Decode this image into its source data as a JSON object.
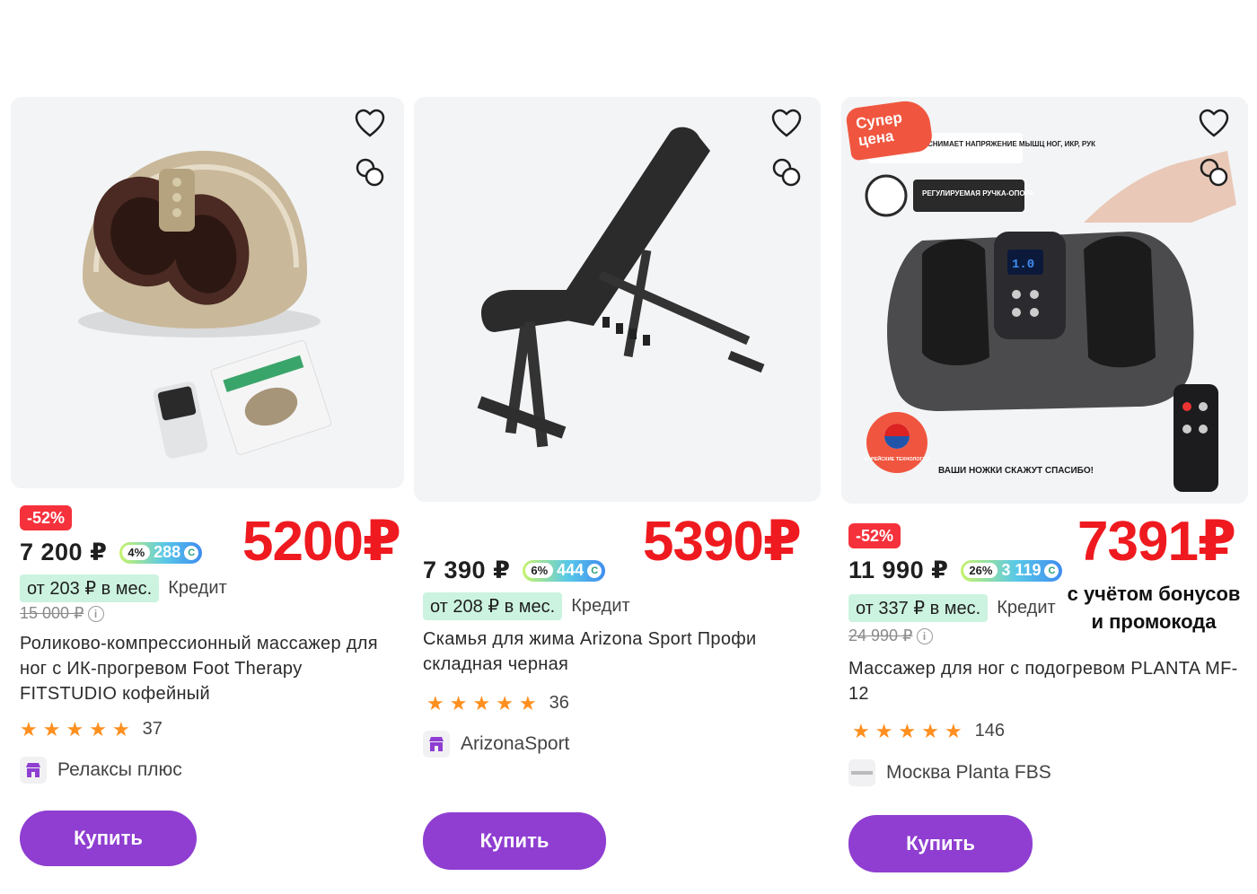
{
  "colors": {
    "discount_red": "#f5313b",
    "promo_red": "#ee1a1f",
    "buy_purple": "#8f3ed1",
    "star_orange": "#ff8f1f",
    "monthly_bg": "#ccf3e0"
  },
  "products": [
    {
      "discount": "-52%",
      "price": "7 200 ₽",
      "bonus_pct": "4%",
      "bonus_amount": "288",
      "monthly": "от 203 ₽ в мес.",
      "credit": "Кредит",
      "old_price": "15 000 ₽",
      "title": "Роликово-компрессионный массажер для ног с ИК-прогревом Foot Therapy FITSTUDIO кофейный",
      "rating_count": "37",
      "seller": "Релаксы плюс",
      "buy_label": "Купить",
      "promo_price": "5200₽"
    },
    {
      "price": "7 390 ₽",
      "bonus_pct": "6%",
      "bonus_amount": "444",
      "monthly": "от 208 ₽ в мес.",
      "credit": "Кредит",
      "title": "Скамья для жима Arizona Sport Профи складная черная",
      "rating_count": "36",
      "seller": "ArizonaSport",
      "buy_label": "Купить",
      "promo_price": "5390₽"
    },
    {
      "badge": "Супер цена",
      "image_texts": [
        "СНИМАЕТ НАПРЯЖЕНИЕ МЫШЦ НОГ, ИКР, РУК",
        "РЕГУЛИРУЕМАЯ РУЧКА-ОПОРА",
        "ВАШИ НОЖКИ СКАЖУТ СПАСИБО!",
        "КОРЕЙСКИЕ ТЕХНОЛОГИИ"
      ],
      "discount": "-52%",
      "price": "11 990 ₽",
      "bonus_pct": "26%",
      "bonus_amount": "3 119",
      "monthly": "от 337 ₽ в мес.",
      "credit": "Кредит",
      "old_price": "24 990 ₽",
      "title": "Массажер для ног с подогревом PLANTA MF-12",
      "rating_count": "146",
      "seller": "Москва Planta FBS",
      "buy_label": "Купить",
      "promo_price": "7391₽",
      "promo_note_1": "с учётом бонусов",
      "promo_note_2": "и промокода"
    }
  ],
  "icons": {
    "favorite": "heart-icon",
    "compare": "compare-icon",
    "seller": "store-icon",
    "info": "info-icon",
    "star": "star-icon"
  }
}
